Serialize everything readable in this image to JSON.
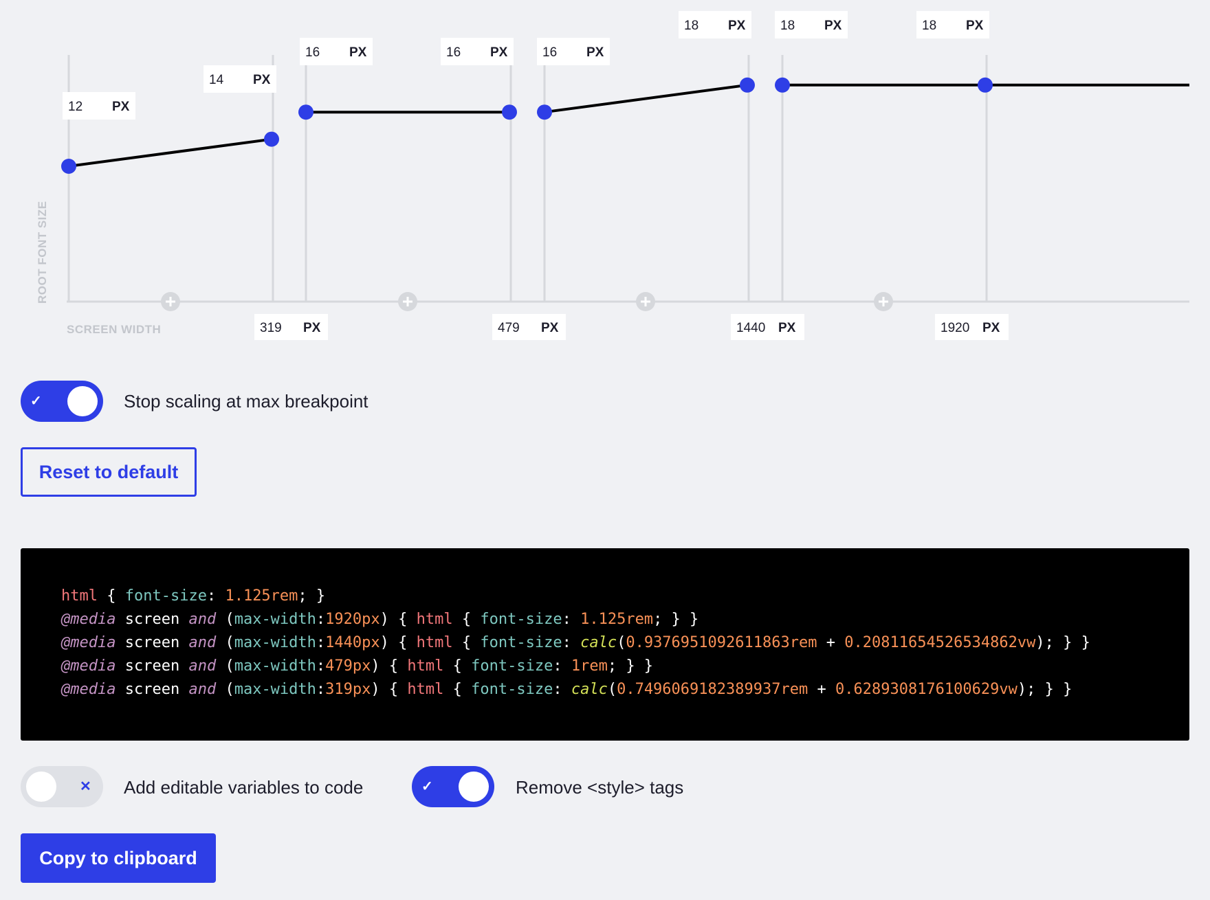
{
  "chart_data": {
    "type": "line",
    "xlabel": "SCREEN WIDTH",
    "ylabel": "ROOT FONT SIZE",
    "unit": "PX",
    "x_breakpoints": [
      {
        "value": "319",
        "unit": "PX"
      },
      {
        "value": "479",
        "unit": "PX"
      },
      {
        "value": "1440",
        "unit": "PX"
      },
      {
        "value": "1920",
        "unit": "PX"
      }
    ],
    "segments": [
      {
        "start_font_size": 12,
        "end_font_size": 14
      },
      {
        "start_font_size": 16,
        "end_font_size": 16
      },
      {
        "start_font_size": 16,
        "end_font_size": 18
      },
      {
        "start_font_size": 18,
        "end_font_size": 18
      }
    ],
    "point_labels": [
      {
        "value": "12",
        "unit": "PX"
      },
      {
        "value": "14",
        "unit": "PX"
      },
      {
        "value": "16",
        "unit": "PX"
      },
      {
        "value": "16",
        "unit": "PX"
      },
      {
        "value": "16",
        "unit": "PX"
      },
      {
        "value": "18",
        "unit": "PX"
      },
      {
        "value": "18",
        "unit": "PX"
      },
      {
        "value": "18",
        "unit": "PX"
      }
    ]
  },
  "controls": {
    "stop_scaling": {
      "label": "Stop scaling at max breakpoint",
      "checked": true,
      "mark": "✓"
    },
    "reset_label": "Reset to default",
    "editable_vars": {
      "label": "Add editable variables to code",
      "checked": false,
      "mark": "✕"
    },
    "remove_style": {
      "label": "Remove <style> tags",
      "checked": true,
      "mark": "✓"
    },
    "copy_label": "Copy to clipboard"
  },
  "code": {
    "lines": [
      [
        [
          "html",
          "tag"
        ],
        [
          " { ",
          "plain"
        ],
        [
          "font-size",
          "prop"
        ],
        [
          ": ",
          "plain"
        ],
        [
          "1.125rem",
          "num"
        ],
        [
          "; }",
          "plain"
        ]
      ],
      [
        [
          "@media",
          "at"
        ],
        [
          " screen ",
          "plain"
        ],
        [
          "and",
          "kw"
        ],
        [
          " (",
          "plain"
        ],
        [
          "max-width",
          "prop"
        ],
        [
          ":",
          "plain"
        ],
        [
          "1920px",
          "num"
        ],
        [
          ") { ",
          "plain"
        ],
        [
          "html",
          "tag"
        ],
        [
          " { ",
          "plain"
        ],
        [
          "font-size",
          "prop"
        ],
        [
          ": ",
          "plain"
        ],
        [
          "1.125rem",
          "num"
        ],
        [
          "; } }",
          "plain"
        ]
      ],
      [
        [
          "@media",
          "at"
        ],
        [
          " screen ",
          "plain"
        ],
        [
          "and",
          "kw"
        ],
        [
          " (",
          "plain"
        ],
        [
          "max-width",
          "prop"
        ],
        [
          ":",
          "plain"
        ],
        [
          "1440px",
          "num"
        ],
        [
          ") { ",
          "plain"
        ],
        [
          "html",
          "tag"
        ],
        [
          " { ",
          "plain"
        ],
        [
          "font-size",
          "prop"
        ],
        [
          ": ",
          "plain"
        ],
        [
          "calc",
          "fn"
        ],
        [
          "(",
          "plain"
        ],
        [
          "0.9376951092611863rem",
          "num"
        ],
        [
          " + ",
          "plain"
        ],
        [
          "0.20811654526534862vw",
          "num"
        ],
        [
          "); } }",
          "plain"
        ]
      ],
      [
        [
          "@media",
          "at"
        ],
        [
          " screen ",
          "plain"
        ],
        [
          "and",
          "kw"
        ],
        [
          " (",
          "plain"
        ],
        [
          "max-width",
          "prop"
        ],
        [
          ":",
          "plain"
        ],
        [
          "479px",
          "num"
        ],
        [
          ") { ",
          "plain"
        ],
        [
          "html",
          "tag"
        ],
        [
          " { ",
          "plain"
        ],
        [
          "font-size",
          "prop"
        ],
        [
          ": ",
          "plain"
        ],
        [
          "1rem",
          "num"
        ],
        [
          "; } }",
          "plain"
        ]
      ],
      [
        [
          "@media",
          "at"
        ],
        [
          " screen ",
          "plain"
        ],
        [
          "and",
          "kw"
        ],
        [
          " (",
          "plain"
        ],
        [
          "max-width",
          "prop"
        ],
        [
          ":",
          "plain"
        ],
        [
          "319px",
          "num"
        ],
        [
          ") { ",
          "plain"
        ],
        [
          "html",
          "tag"
        ],
        [
          " { ",
          "plain"
        ],
        [
          "font-size",
          "prop"
        ],
        [
          ": ",
          "plain"
        ],
        [
          "calc",
          "fn"
        ],
        [
          "(",
          "plain"
        ],
        [
          "0.7496069182389937rem",
          "num"
        ],
        [
          " + ",
          "plain"
        ],
        [
          "0.6289308176100629vw",
          "num"
        ],
        [
          "); } }",
          "plain"
        ]
      ]
    ]
  },
  "colors": {
    "accent": "#2e3ee6",
    "background": "#f0f1f4",
    "code_background": "#000000"
  },
  "icons": {
    "add_breakpoint": "plus-circle-icon",
    "toggle_on": "check-icon",
    "toggle_off": "x-icon"
  }
}
